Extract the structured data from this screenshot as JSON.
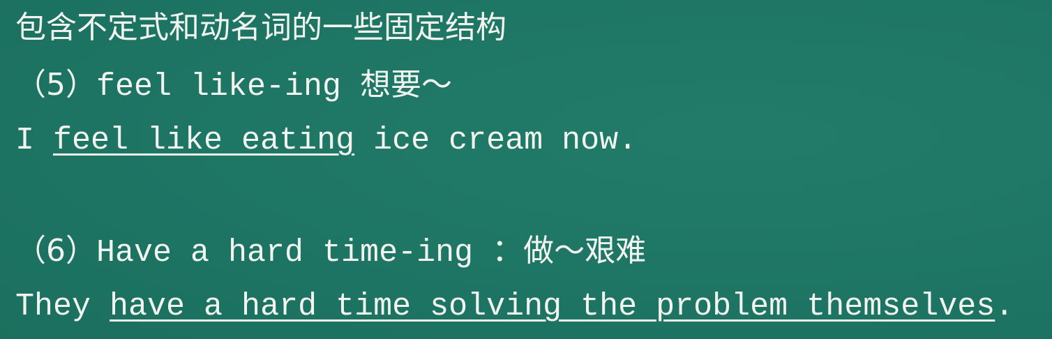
{
  "title": "包含不定式和动名词的一些固定结构",
  "item5": {
    "number": "（5）",
    "phrase": "feel like‐ing ",
    "meaning": "想要～",
    "example": {
      "before": "I ",
      "underlined": "feel like eating",
      "after": " ice cream now."
    }
  },
  "item6": {
    "number": "（6）",
    "phrase": "Have a hard time-ing ：",
    "meaning": "做～艰难",
    "example": {
      "before": "They ",
      "underlined": "have a hard time solving the problem themselves",
      "after": "."
    }
  },
  "colors": {
    "background": "#1e7564",
    "text": "#f2f4ef"
  }
}
